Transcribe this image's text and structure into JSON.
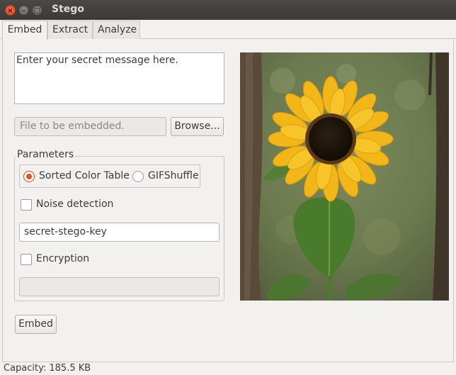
{
  "window": {
    "title": "Stego",
    "buttons": {
      "close": "×",
      "minimize": "–",
      "maximize": "□"
    }
  },
  "tabs": [
    {
      "label": "Embed",
      "active": true
    },
    {
      "label": "Extract",
      "active": false
    },
    {
      "label": "Analyze",
      "active": false
    }
  ],
  "embed": {
    "message_value": "Enter your secret message here.",
    "file_placeholder": "File to be embedded.",
    "browse_label": "Browse...",
    "parameters": {
      "title": "Parameters",
      "methods": [
        {
          "label": "Sorted Color Table",
          "selected": true
        },
        {
          "label": "GIFShuffle",
          "selected": false
        }
      ],
      "noise_detection": {
        "label": "Noise detection",
        "checked": false
      },
      "key_value": "secret-stego-key",
      "encryption": {
        "label": "Encryption",
        "checked": false
      },
      "encryption_value": ""
    },
    "embed_label": "Embed"
  },
  "preview": {
    "image_icon": "sunflower-photo",
    "colors": {
      "petal": "#f3b618",
      "center": "#1e150d",
      "leaf": "#4f7a2e",
      "background": "#6f7d55"
    }
  },
  "status": {
    "capacity": "Capacity: 185.5 KB"
  },
  "theme": {
    "accent": "#e95420",
    "titlebar": "#3c3b37"
  }
}
